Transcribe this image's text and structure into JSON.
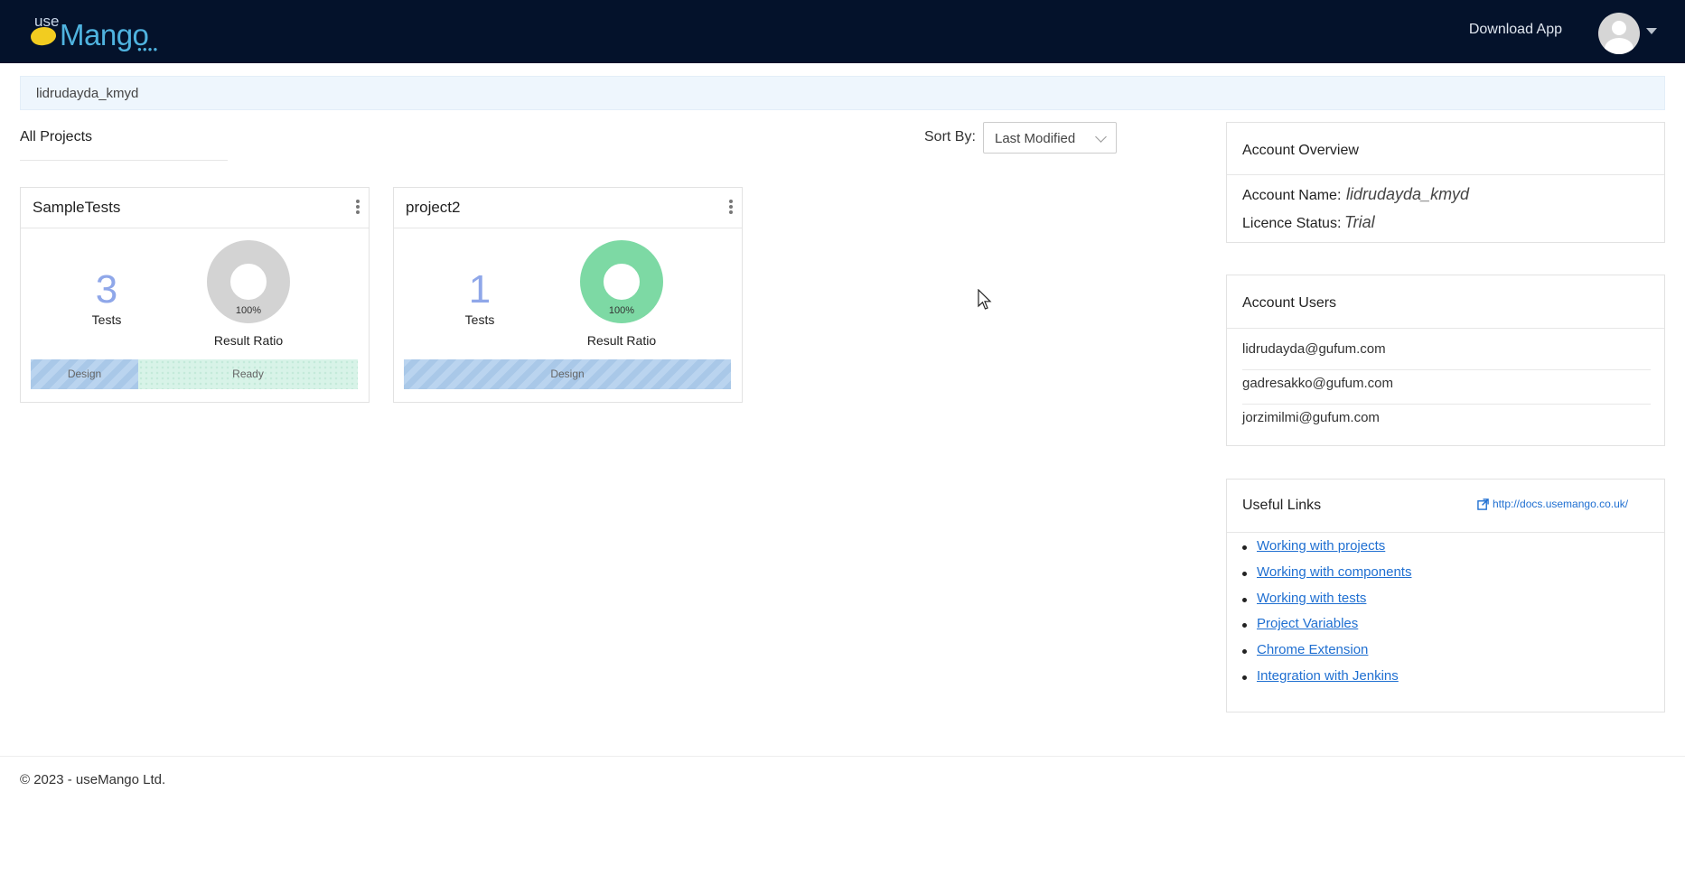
{
  "nav": {
    "logo_use": "use",
    "logo_mango": "Mango",
    "download_label": "Download App"
  },
  "breadcrumb": {
    "account": "lidrudayda_kmyd"
  },
  "projects": {
    "heading": "All Projects",
    "sort_label": "Sort By:",
    "sort_value": "Last Modified",
    "cards": [
      {
        "name": "SampleTests",
        "test_count": "3",
        "tests_label": "Tests",
        "ratio_percent": "100%",
        "ratio_label": "Result Ratio",
        "ratio_color": "#d3d3d3",
        "status": [
          {
            "label": "Design",
            "fraction": 0.33
          },
          {
            "label": "Ready",
            "fraction": 0.67
          }
        ]
      },
      {
        "name": "project2",
        "test_count": "1",
        "tests_label": "Tests",
        "ratio_percent": "100%",
        "ratio_label": "Result Ratio",
        "ratio_color": "#7dd9a4",
        "status": [
          {
            "label": "Design",
            "fraction": 1.0
          }
        ]
      }
    ]
  },
  "account_overview": {
    "title": "Account Overview",
    "name_label": "Account Name:",
    "name_value": "lidrudayda_kmyd",
    "licence_label": "Licence Status:",
    "licence_value": "Trial"
  },
  "account_users": {
    "title": "Account Users",
    "users": [
      "lidrudayda@gufum.com",
      "gadresakko@gufum.com",
      "jorzimilmi@gufum.com"
    ]
  },
  "useful_links": {
    "title": "Useful Links",
    "docs_link": "http://docs.usemango.co.uk/",
    "items": [
      "Working with projects",
      "Working with components",
      "Working with tests",
      "Project Variables",
      "Chrome Extension",
      "Integration with Jenkins"
    ]
  },
  "footer": {
    "copyright": "© 2023 - useMango Ltd."
  },
  "colors": {
    "navbar": "#04122b",
    "accent_blue": "#4fb3df",
    "count_blue": "#8fa7e9",
    "link_blue": "#1f6fd1"
  }
}
